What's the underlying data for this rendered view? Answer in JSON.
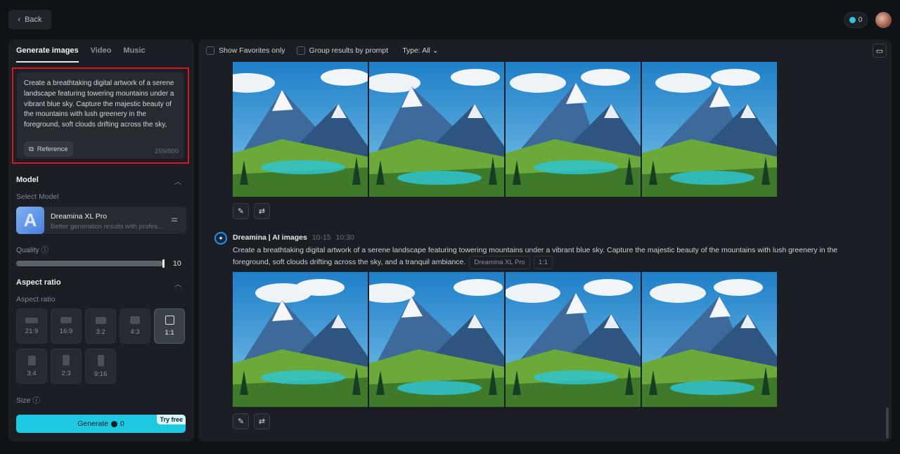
{
  "header": {
    "back_label": "Back",
    "credits": "0"
  },
  "sidebar": {
    "tabs": [
      {
        "label": "Generate images",
        "active": true
      },
      {
        "label": "Video"
      },
      {
        "label": "Music"
      }
    ],
    "prompt": {
      "text": "Create a breathtaking digital artwork of a serene landscape featuring towering mountains under a vibrant blue sky. Capture the majestic beauty of the mountains with lush greenery in the foreground, soft clouds drifting across the sky, and a tranquil ambiance.",
      "reference_label": "Reference",
      "char_count": "259/800"
    },
    "model": {
      "section": "Model",
      "select_label": "Select Model",
      "name": "Dreamina XL Pro",
      "description": "Better generation results with profes...",
      "logo_letter": "A"
    },
    "quality": {
      "label": "Quality",
      "value": "10",
      "fraction": 1.0
    },
    "aspect": {
      "section": "Aspect ratio",
      "label": "Aspect ratio",
      "options": [
        "21:9",
        "16:9",
        "3:2",
        "4:3",
        "1:1",
        "3:4",
        "2:3",
        "9:16"
      ],
      "selected": "1:1"
    },
    "size": {
      "label": "Size"
    },
    "generate": {
      "label": "Generate",
      "credits": "0",
      "badge": "Try free"
    },
    "accent": "#1ec8e2"
  },
  "main": {
    "filters": {
      "favorites": "Show Favorites only",
      "group": "Group results by prompt",
      "type": "Type: All"
    },
    "results": [
      {
        "images": 4
      },
      {
        "author": "Dreamina | AI images",
        "date": "10-15",
        "time": "10:30",
        "prompt": "Create a breathtaking digital artwork of a serene landscape featuring towering mountains under a vibrant blue sky. Capture the majestic beauty of the mountains with lush greenery in the foreground, soft clouds drifting across the sky, and a tranquil ambiance.",
        "model_tag": "Dreamina XL Pro",
        "ratio_tag": "1:1",
        "images": 4
      }
    ]
  }
}
